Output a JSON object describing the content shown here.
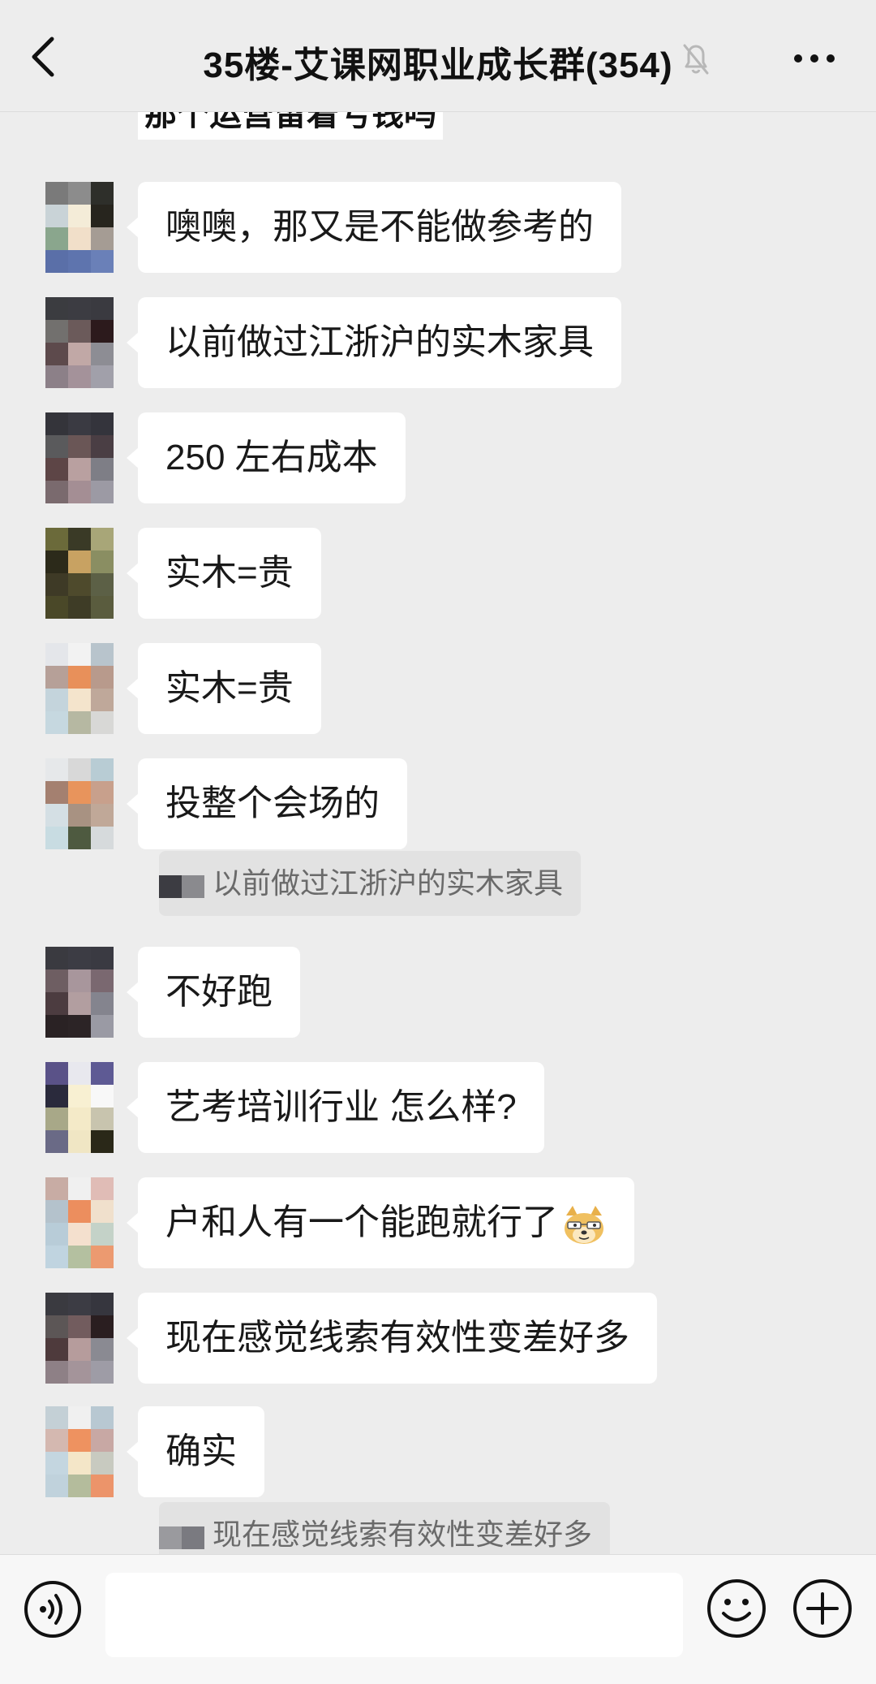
{
  "header": {
    "title": "35楼-艾课网职业成长群(354)",
    "back_icon": "chevron-left-icon",
    "mute_icon": "bell-muted-icon",
    "more_icon": "more-icon"
  },
  "chat": {
    "cut_off_message": "那个运营留着亏钱吗",
    "messages": [
      {
        "text": "噢噢，那又是不能做参考的"
      },
      {
        "text": "以前做过江浙沪的实木家具"
      },
      {
        "text": "250 左右成本"
      },
      {
        "text": "实木=贵"
      },
      {
        "text": "实木=贵"
      },
      {
        "text": "投整个会场的"
      },
      {
        "text": "不好跑"
      },
      {
        "text": "艺考培训行业 怎么样?"
      },
      {
        "text": "户和人有一个能跑就行了",
        "emoji": "doge-emoji"
      },
      {
        "text": "现在感觉线索有效性变差好多"
      },
      {
        "text": "确实"
      }
    ],
    "quotes": [
      {
        "text": "以前做过江浙沪的实木家具"
      },
      {
        "text": "现在感觉线索有效性变差好多"
      }
    ]
  },
  "input_bar": {
    "voice_icon": "voice-icon",
    "input_value": "",
    "emoji_icon": "emoji-icon",
    "plus_icon": "plus-icon"
  },
  "colors": {
    "background": "#ededed",
    "bubble": "#ffffff",
    "quote_bg": "#e2e2e2",
    "text": "#191919",
    "quote_text": "#6a6a6a"
  }
}
